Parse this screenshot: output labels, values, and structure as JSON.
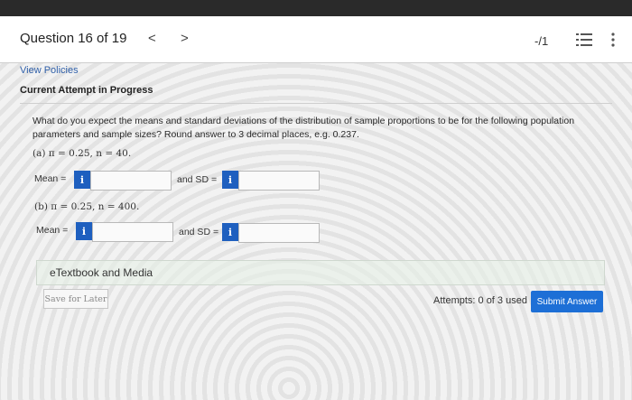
{
  "header": {
    "question_counter": "Question 16 of 19",
    "prev_glyph": "<",
    "next_glyph": ">",
    "score": "-/1"
  },
  "links": {
    "view_policies": "View Policies"
  },
  "attempt_heading": "Current Attempt in Progress",
  "question": {
    "text": "What do you expect the means and standard deviations of the distribution of sample proportions to be for the following population parameters and sample sizes? Round answer to 3 decimal places, e.g. 0.237.",
    "part_a": "(a) π = 0.25, n = 40.",
    "part_b": "(b) π = 0.25, n = 400."
  },
  "fields": {
    "mean_label": "Mean =",
    "sd_label": "and SD =",
    "info_glyph": "i",
    "mean_a_value": "",
    "sd_a_value": "",
    "mean_b_value": "",
    "sd_b_value": ""
  },
  "etextbook": "eTextbook and Media",
  "footer": {
    "save_label": "Save for Later",
    "attempts": "Attempts: 0 of 3 used",
    "submit_label": "Submit Answer"
  },
  "colors": {
    "accent": "#1d6fd6",
    "info_button": "#1e5fbf",
    "link": "#2f5fa8"
  },
  "icons": {
    "prev": "chevron-left-icon",
    "next": "chevron-right-icon",
    "list": "list-icon",
    "more": "more-vertical-icon"
  }
}
